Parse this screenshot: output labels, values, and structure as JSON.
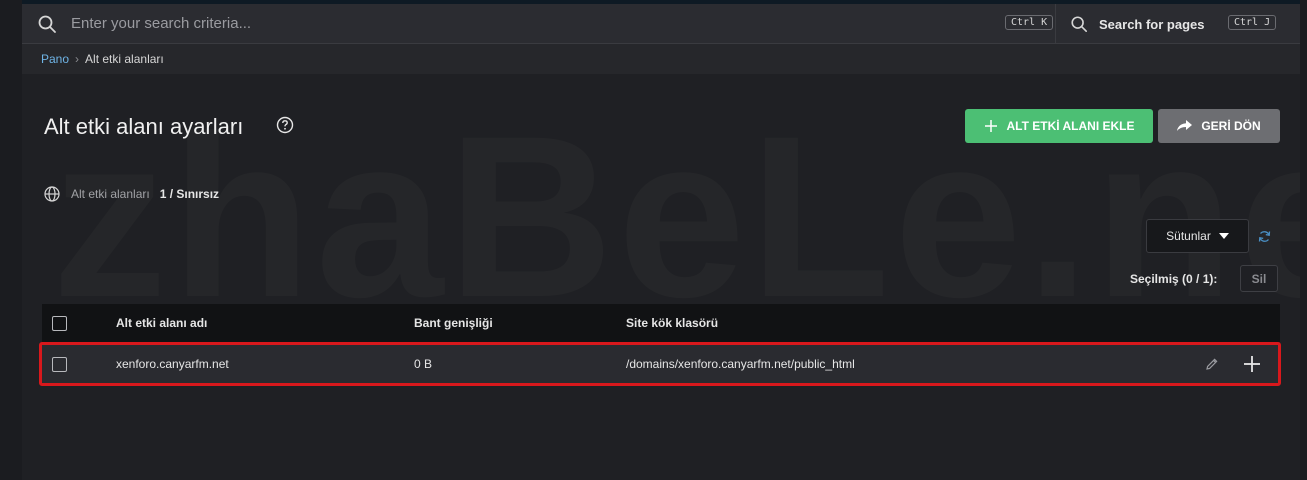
{
  "search": {
    "placeholder": "Enter your search criteria...",
    "shortcut": "Ctrl K",
    "pages_label": "Search for pages",
    "pages_shortcut": "Ctrl J"
  },
  "breadcrumb": {
    "home": "Pano",
    "separator": "›",
    "current": "Alt etki alanları"
  },
  "page": {
    "title": "Alt etki alanı ayarları",
    "watermark": "zhaBeLe.net",
    "buttons": {
      "add": "ALT ETKİ ALANI EKLE",
      "back": "GERİ DÖN"
    },
    "stat": {
      "label": "Alt etki alanları",
      "value": "1 / Sınırsız"
    },
    "columns_button": "Sütunlar",
    "selected_label": "Seçilmiş (0 / 1):",
    "delete_label": "Sil"
  },
  "table": {
    "headers": [
      "Alt etki alanı adı",
      "Bant genişliği",
      "Site kök klasörü"
    ],
    "rows": [
      {
        "name": "xenforo.canyarfm.net",
        "bandwidth": "0 B",
        "root": "/domains/xenforo.canyarfm.net/public_html"
      }
    ]
  },
  "colors": {
    "accent_green": "#4cbf74",
    "back_gray": "#6d6e72",
    "highlight_red": "#d8181c",
    "link_blue": "#6fb4e6"
  }
}
